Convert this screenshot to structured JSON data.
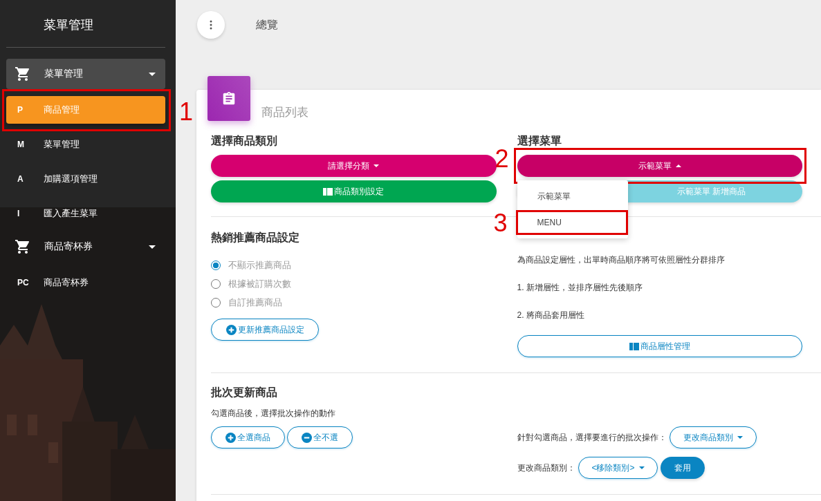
{
  "sidebar": {
    "title": "菜單管理",
    "groups": [
      {
        "label": "菜單管理",
        "active": true,
        "children": [
          {
            "abbr": "P",
            "label": "商品管理",
            "selected": true,
            "callout": "1"
          },
          {
            "abbr": "M",
            "label": "菜單管理",
            "selected": false
          },
          {
            "abbr": "A",
            "label": "加購選項管理",
            "selected": false
          },
          {
            "abbr": "I",
            "label": "匯入產生菜單",
            "selected": false
          }
        ]
      },
      {
        "label": "商品寄杯券",
        "active": false,
        "children": [
          {
            "abbr": "PC",
            "label": "商品寄杯券",
            "selected": false
          }
        ]
      }
    ]
  },
  "topbar": {
    "title": "總覽"
  },
  "card": {
    "title": "商品列表"
  },
  "category": {
    "heading": "選擇商品類別",
    "dropdown": "請選擇分類",
    "settings_button": "商品類別設定"
  },
  "menu": {
    "heading": "選擇菜單",
    "dropdown": {
      "label": "示範菜單",
      "open": true,
      "callout": "2",
      "options": [
        {
          "label": "示範菜單",
          "selected": false
        },
        {
          "label": "MENU",
          "selected": false,
          "callout": "3"
        }
      ]
    },
    "add_button": "示範菜單 新增商品"
  },
  "hot": {
    "heading": "熱銷推薦商品設定",
    "options": [
      {
        "label": "不顯示推薦商品",
        "selected": true
      },
      {
        "label": "根據被訂購次數",
        "selected": false
      },
      {
        "label": "自訂推薦商品",
        "selected": false
      }
    ],
    "button": "更新推薦商品設定"
  },
  "attributes": {
    "description": "為商品設定層性，出單時商品順序將可依照層性分群排序",
    "steps": [
      "1. 新增層性，並排序層性先後順序",
      "2. 將商品套用層性"
    ],
    "button": "商品層性管理"
  },
  "batch": {
    "heading": "批次更新商品",
    "hint": "勾選商品後，選擇批次操作的動作",
    "buttons": [
      {
        "label": "全選商品",
        "kind": "plus"
      },
      {
        "label": "全不選",
        "kind": "minus"
      }
    ],
    "action_label": "針對勾選商品，選擇要進行的批次操作：",
    "action_dropdown": "更改商品類別",
    "category_label": "更改商品類別：",
    "category_dropdown": "<移除類別>",
    "apply": "套用"
  }
}
